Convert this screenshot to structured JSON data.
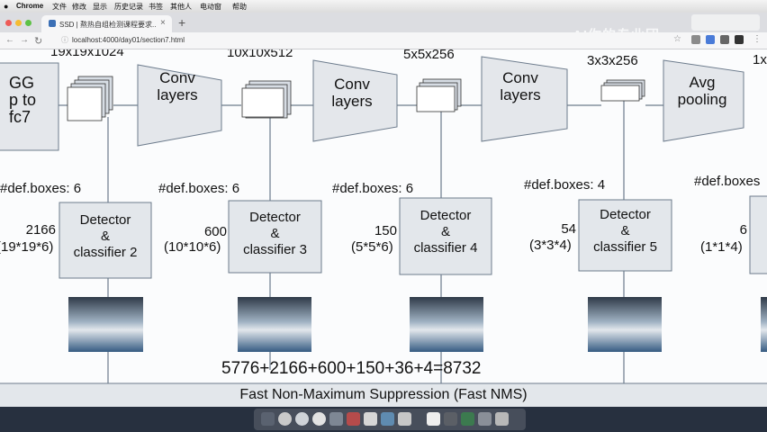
{
  "menubar": {
    "app": "Chrome",
    "items": [
      "文件",
      "修改",
      "显示",
      "历史记录",
      "书签",
      "其他人",
      "电动窗",
      "帮助"
    ]
  },
  "tab": {
    "title": "SSD | 熬热自组检测课程要求.."
  },
  "address": {
    "url": "localhost:4000/day01/section7.html"
  },
  "watermark": "AI你的专业团",
  "diagram": {
    "stages": [
      {
        "size": "19x19x1024",
        "def_boxes": "#def.boxes: 6",
        "count": "2166",
        "formula": "(19*19*6)",
        "detector_line1": "Detector",
        "detector_line2": "&",
        "detector_line3": "classifier 2"
      },
      {
        "size": "10x10x512",
        "def_boxes": "#def.boxes: 6",
        "count": "600",
        "formula": "(10*10*6)",
        "detector_line1": "Detector",
        "detector_line2": "&",
        "detector_line3": "classifier 3"
      },
      {
        "size": "5x5x256",
        "def_boxes": "#def.boxes: 6",
        "count": "150",
        "formula": "(5*5*6)",
        "detector_line1": "Detector",
        "detector_line2": "&",
        "detector_line3": "classifier 4"
      },
      {
        "size": "3x3x256",
        "def_boxes": "#def.boxes: 4",
        "count": "54",
        "formula": "(3*3*4)",
        "detector_line1": "Detector",
        "detector_line2": "&",
        "detector_line3": "classifier 5"
      },
      {
        "size": "1x",
        "def_boxes": "#def.boxes",
        "count": "6",
        "formula": "(1*1*4)"
      }
    ],
    "vgg": {
      "line1": "GG",
      "line2": "p to",
      "line3": "fc7"
    },
    "conv1": {
      "line1": "Conv",
      "line2": "layers"
    },
    "conv2": {
      "line1": "Conv",
      "line2": "layers"
    },
    "conv3": {
      "line1": "Conv",
      "line2": "layers"
    },
    "avgpool": {
      "line1": "Avg",
      "line2": "pooling"
    },
    "sum": "5776+2166+600+150+36+4=8732",
    "nms": "Fast Non-Maximum Suppression (Fast NMS)"
  }
}
